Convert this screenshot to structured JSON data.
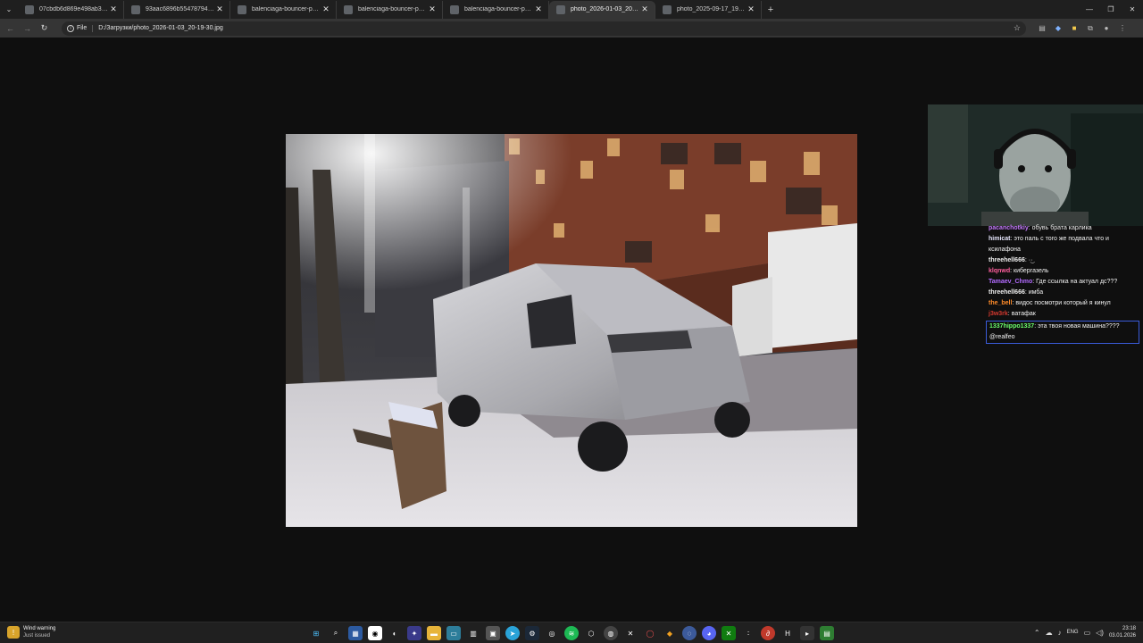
{
  "tabs": [
    {
      "title": "07cbdb6d869e498ab33ed1afc...",
      "active": false
    },
    {
      "title": "93aac6896b554787941 5af16dc...",
      "active": false
    },
    {
      "title": "balenciaga-bouncer-purple-kno...",
      "active": false
    },
    {
      "title": "balenciaga-bouncer-purple-kno...",
      "active": false
    },
    {
      "title": "balenciaga-bouncer-purple-kno...",
      "active": false
    },
    {
      "title": "photo_2026-01-03_20-19-30.jp...",
      "active": true
    },
    {
      "title": "photo_2025-09-17_19-04-26.jp...",
      "active": false
    }
  ],
  "toolbar": {
    "file_chip": "File",
    "url": "D:/Загрузки/photo_2026-01-03_20-19-30.jpg"
  },
  "chat": [
    {
      "user": "pacanchotkiy",
      "color": "#c77dff",
      "text": "обувь брата карлика"
    },
    {
      "user": "himicat",
      "color": "#e8e8ff",
      "text": "это паль с того же подвала что и ксилафона"
    },
    {
      "user": "threehell666",
      "color": "#f0f0f0",
      "text": "·͜·"
    },
    {
      "user": "klqnwd",
      "color": "#ff5f9e",
      "text": "кибергазель"
    },
    {
      "user": "Tamaev_Chmo",
      "color": "#b26bff",
      "text": "Где ссылка на актуал дс???"
    },
    {
      "user": "threehell666",
      "color": "#f0f0f0",
      "text": "имба"
    },
    {
      "user": "the_bell",
      "color": "#ff8c2a",
      "text": "видос посмотри который я кинул"
    },
    {
      "user": "j3w3rk",
      "color": "#d6392f",
      "text": "ватафак"
    },
    {
      "user": "1337hippo1337",
      "color": "#6cff6c",
      "text": "эта твоя новая машина???? @realfeo",
      "highlight": true
    }
  ],
  "taskbar": {
    "weather_title": "Wind warning",
    "weather_sub": "Just issued",
    "lang": "ENG",
    "time": "23:18",
    "date": "03.01.2026"
  },
  "icons": [
    "menu-icon",
    "back-icon",
    "forward-icon",
    "reload-icon",
    "star-icon",
    "extensions-icon",
    "profile-icon",
    "windows-start-icon",
    "search-icon",
    "chrome-icon",
    "wind-warning-icon"
  ]
}
